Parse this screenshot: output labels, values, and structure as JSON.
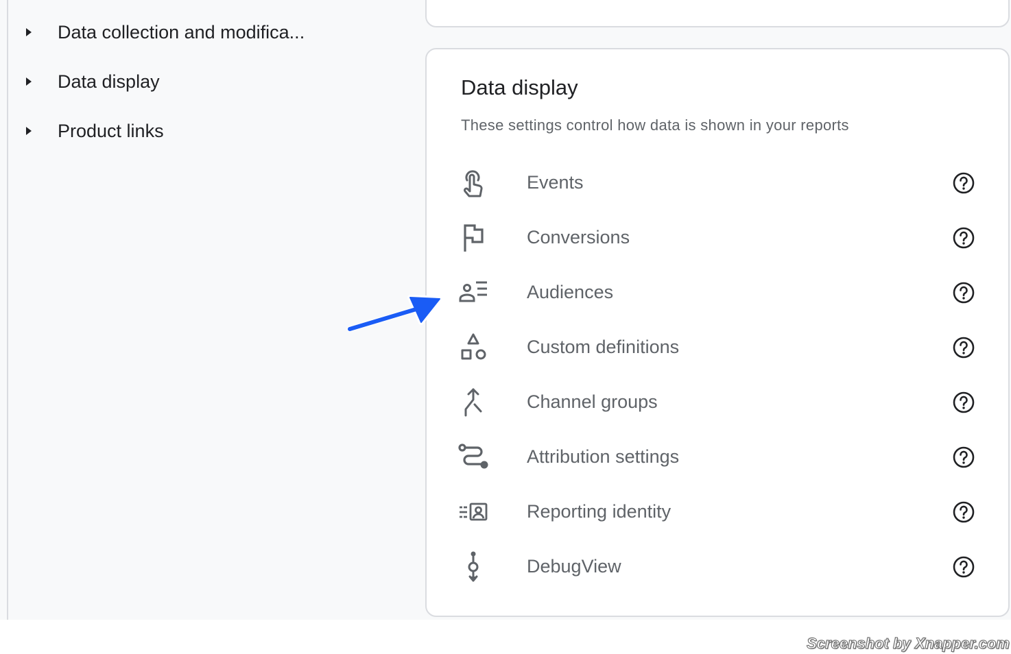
{
  "sidebar": {
    "items": [
      {
        "label": "Data collection and modifica..."
      },
      {
        "label": "Data display"
      },
      {
        "label": "Product links"
      }
    ]
  },
  "card": {
    "title": "Data display",
    "subtitle": "These settings control how data is shown in your reports",
    "rows": [
      {
        "label": "Events",
        "icon": "touch-icon"
      },
      {
        "label": "Conversions",
        "icon": "flag-icon"
      },
      {
        "label": "Audiences",
        "icon": "audience-list-icon"
      },
      {
        "label": "Custom definitions",
        "icon": "shapes-icon"
      },
      {
        "label": "Channel groups",
        "icon": "merge-icon"
      },
      {
        "label": "Attribution settings",
        "icon": "route-icon"
      },
      {
        "label": "Reporting identity",
        "icon": "reporting-identity-icon"
      },
      {
        "label": "DebugView",
        "icon": "debug-timeline-icon"
      }
    ]
  },
  "annotation": {
    "color": "#1a5cf5"
  },
  "watermark": {
    "text": "Screenshot by Xnapper.com"
  },
  "colors": {
    "sidebar_bg": "#f8f9fa",
    "text_primary": "#202124",
    "text_secondary": "#5f6368",
    "icon": "#5f6368",
    "border": "#dadce0"
  }
}
